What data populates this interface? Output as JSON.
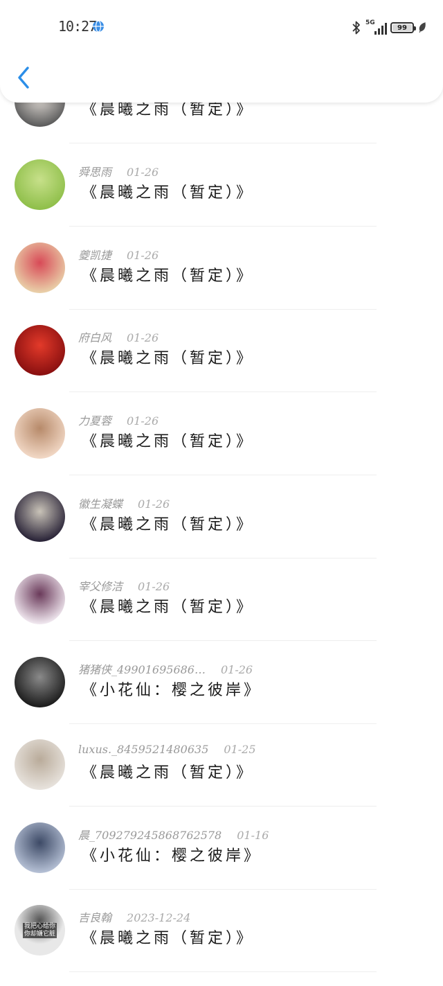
{
  "status_bar": {
    "time": "10:27",
    "network": "5G",
    "battery": "99",
    "battery_fraction": 0.99
  },
  "header": {
    "back_icon": "chevron-left-icon"
  },
  "list": [
    {
      "name": "",
      "date": "",
      "message": "《晨曦之雨（暂定）》",
      "avatar_colors": [
        "#5c5c5c",
        "#e8e2dc"
      ]
    },
    {
      "name": "舜思雨",
      "date": "01-26",
      "message": "《晨曦之雨（暂定）》",
      "avatar_colors": [
        "#8fbf4a",
        "#c7e08a"
      ]
    },
    {
      "name": "夔凯捷",
      "date": "01-26",
      "message": "《晨曦之雨（暂定）》",
      "avatar_colors": [
        "#e9cfa8",
        "#d84a57"
      ]
    },
    {
      "name": "府白风",
      "date": "01-26",
      "message": "《晨曦之雨（暂定）》",
      "avatar_colors": [
        "#8a1010",
        "#e33a2a"
      ]
    },
    {
      "name": "力夏蓉",
      "date": "01-26",
      "message": "《晨曦之雨（暂定）》",
      "avatar_colors": [
        "#f1d7c4",
        "#b78a6a"
      ]
    },
    {
      "name": "徽生凝蝶",
      "date": "01-26",
      "message": "《晨曦之雨（暂定）》",
      "avatar_colors": [
        "#2a2438",
        "#c9c3b8"
      ]
    },
    {
      "name": "宰父修洁",
      "date": "01-26",
      "message": "《晨曦之雨（暂定）》",
      "avatar_colors": [
        "#efe6ee",
        "#6a3a5a"
      ]
    },
    {
      "name": "猪猪侠_49901695686…",
      "date": "01-26",
      "message": "《小花仙：樱之彼岸》",
      "avatar_colors": [
        "#1c1c1c",
        "#8a8a8a"
      ]
    },
    {
      "name": "luxus._8459521480635",
      "date": "01-25",
      "message": "《晨曦之雨（暂定）》",
      "avatar_colors": [
        "#e7e2dc",
        "#b9ab9a"
      ]
    },
    {
      "name": "晨_709279245868762578",
      "date": "01-16",
      "message": "《小花仙：樱之彼岸》",
      "avatar_colors": [
        "#b4bfd4",
        "#3d4a66"
      ]
    },
    {
      "name": "吉良翰",
      "date": "2023-12-24",
      "message": "《晨曦之雨（暂定）》",
      "avatar_colors": [
        "#f0f0f0",
        "#222222"
      ],
      "avatar_text": [
        "我把心给你",
        "你却嫌它脏"
      ]
    }
  ]
}
